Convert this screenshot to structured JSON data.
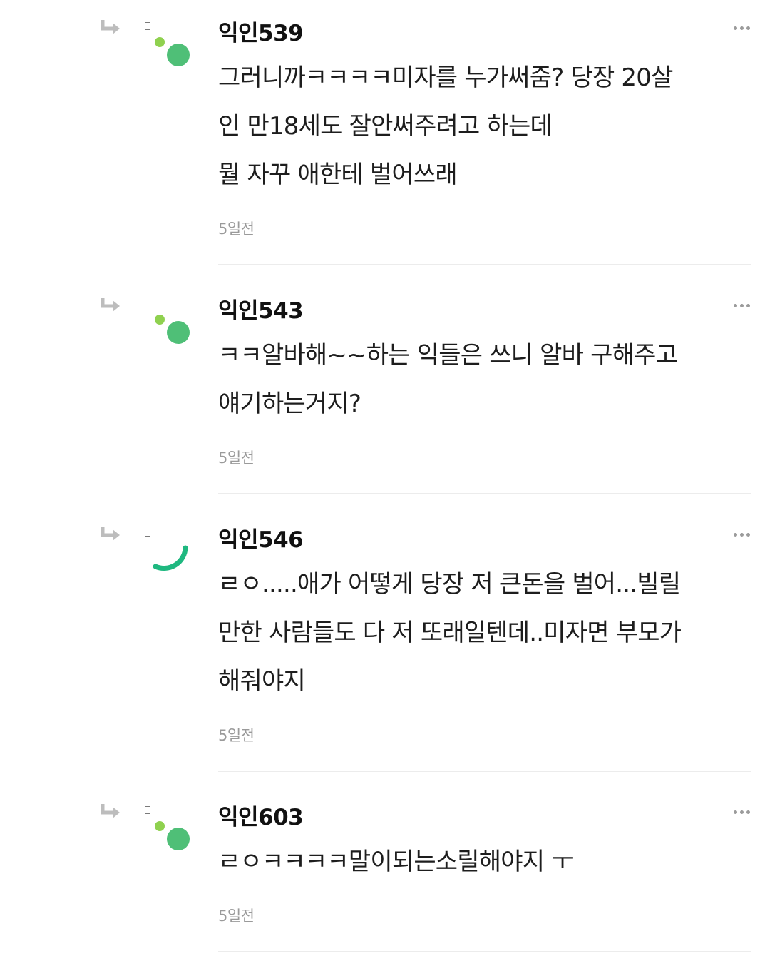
{
  "comments": [
    {
      "nickname": "익인539",
      "lines": [
        "그러니까ㅋㅋㅋㅋ미자를 누가써줌? 당장 20살",
        "인 만18세도 잘안써주려고 하는데",
        "뭘 자꾸 애한테 벌어쓰래"
      ],
      "time": "5일전",
      "avatar": "dots"
    },
    {
      "nickname": "익인543",
      "lines": [
        "ㅋㅋ알바해~~하는 익들은 쓰니 알바 구해주고",
        "얘기하는거지?"
      ],
      "time": "5일전",
      "avatar": "dots"
    },
    {
      "nickname": "익인546",
      "lines": [
        "ㄹㅇ.....애가 어떻게 당장 저 큰돈을 벌어...빌릴",
        "만한 사람들도 다 저 또래일텐데..미자면 부모가",
        "해줘야지"
      ],
      "time": "5일전",
      "avatar": "arc"
    },
    {
      "nickname": "익인603",
      "lines": [
        "ㄹㅇㅋㅋㅋㅋ말이되는소릴해야지 ㅜ"
      ],
      "time": "5일전",
      "avatar": "dots"
    }
  ],
  "icons": {
    "reply": "reply-arrow-icon",
    "more": "more-options-icon"
  },
  "colors": {
    "accent_light_green": "#8fd14f",
    "accent_green": "#4fbf77",
    "accent_arc_green": "#1fb880",
    "reply_icon": "#bdbdbd",
    "timestamp": "#9a9a9a",
    "divider": "#ececec"
  }
}
